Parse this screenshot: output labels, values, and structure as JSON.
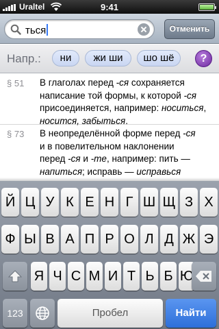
{
  "status": {
    "carrier": "Uraltel",
    "time": "9:41"
  },
  "search": {
    "value": "ться",
    "cancel_label": "Отменить"
  },
  "hints": {
    "label": "Напр.:",
    "chips": [
      "ни",
      "жи ши",
      "шо шё"
    ],
    "help": "?"
  },
  "results": [
    {
      "number": "§ 51",
      "lines": [
        "В глаголах перед ",
        "-ся",
        " сохраняется",
        "написание той формы, к которой ",
        "-ся",
        "присоединяется, например: ",
        "носиться",
        ",",
        "носится, забыться",
        "."
      ]
    },
    {
      "number": "§ 73",
      "lines": [
        "В неопределённой форме перед ",
        "-ся",
        "и в повелительном наклонении",
        "перед ",
        "-ся",
        " и ",
        "-те",
        ", например: пить —",
        "напиться",
        "; исправь — ",
        "исправься"
      ]
    }
  ],
  "keyboard": {
    "row1": [
      "Й",
      "Ц",
      "У",
      "К",
      "Е",
      "Н",
      "Г",
      "Ш",
      "Щ",
      "З",
      "Х"
    ],
    "row2": [
      "Ф",
      "Ы",
      "В",
      "А",
      "П",
      "Р",
      "О",
      "Л",
      "Д",
      "Ж",
      "Э"
    ],
    "row3": [
      "Я",
      "Ч",
      "С",
      "М",
      "И",
      "Т",
      "Ь",
      "Б",
      "Ю"
    ],
    "numbers_label": "123",
    "space_label": "Пробел",
    "return_label": "Найти",
    "shift_icon": "shift-arrow",
    "globe_icon": "globe",
    "backspace_icon": "backspace"
  }
}
